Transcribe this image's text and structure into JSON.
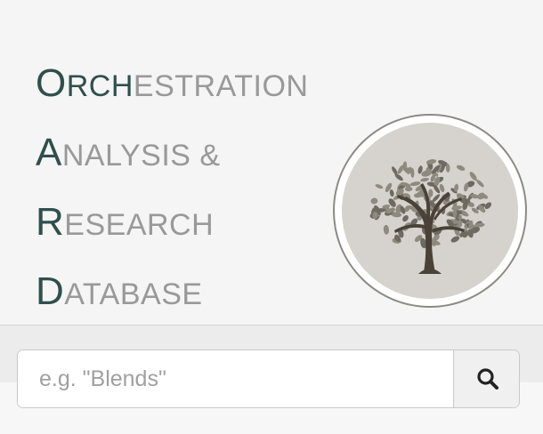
{
  "header": {
    "title_lines": [
      {
        "cap": "O",
        "accent": "RCH",
        "rest": "ESTRATION"
      },
      {
        "cap": "A",
        "accent": "",
        "rest": "NALYSIS &"
      },
      {
        "cap": "R",
        "accent": "",
        "rest": "ESEARCH"
      },
      {
        "cap": "D",
        "accent": "",
        "rest": "ATABASE"
      }
    ]
  },
  "logo": {
    "icon": "tree-icon",
    "background_color": "#d6d3ce",
    "trunk_color": "#4a4238",
    "leaf_color": "#8f8a80"
  },
  "search": {
    "placeholder": "e.g. \"Blends\"",
    "value": "",
    "button_icon": "search-icon"
  },
  "colors": {
    "title_accent": "#2f4f4b",
    "title_text": "#999999"
  }
}
